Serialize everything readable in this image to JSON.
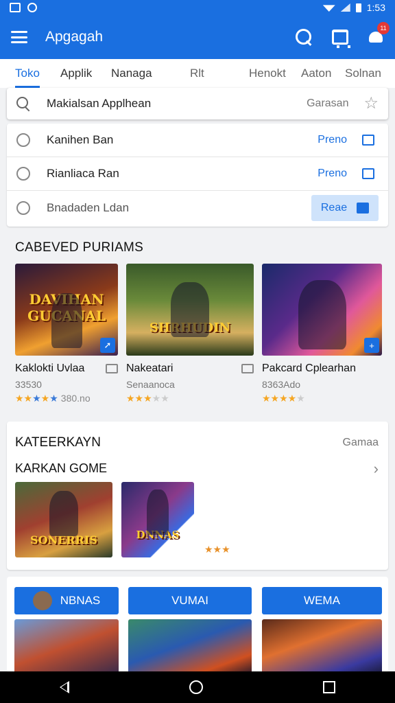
{
  "status_bar": {
    "time": "1:53"
  },
  "app_bar": {
    "title": "Apgagah",
    "notification_count": "11"
  },
  "tabs": [
    {
      "label": "Toko",
      "active": true
    },
    {
      "label": "Applik",
      "active": false
    },
    {
      "label": "Nanaga",
      "active": false
    },
    {
      "label": "Rlt",
      "active": false
    },
    {
      "label": "Henokt",
      "active": false
    },
    {
      "label": "Aaton",
      "active": false
    },
    {
      "label": "Solnan",
      "active": false
    }
  ],
  "search": {
    "query": "Makialsan Applhean",
    "scope": "Garasan"
  },
  "list": [
    {
      "label": "Kanihen Ban",
      "tag": "Preno",
      "selected": false
    },
    {
      "label": "Rianliaca Ran",
      "tag": "Preno",
      "selected": false
    },
    {
      "label": "Bnadaden Ldan",
      "tag": "Reae",
      "selected": true
    }
  ],
  "section_featured": {
    "title": "CABEVED PURIAMS",
    "games": [
      {
        "art_title": "DAVIHAN GUCANAL",
        "name": "Kaklokti Uvlaa",
        "sub": "33530",
        "rating": 4,
        "rating_text": "380.no"
      },
      {
        "art_title": "SHRHUDIN",
        "name": "Nakeatari",
        "sub": "Senaanoca",
        "rating": 3,
        "rating_text": ""
      },
      {
        "art_title": "",
        "name": "Pakcard Cplearhan",
        "sub": "8363Ado",
        "rating": 4,
        "rating_text": ""
      }
    ]
  },
  "section_category": {
    "title": "KATEERKAYN",
    "action": "Gamaa",
    "subtitle": "KARKAN GOME",
    "thumbs": [
      {
        "art_title": "SONERRIS"
      },
      {
        "art_title": "DNNAS"
      }
    ],
    "rating": 3
  },
  "categories": [
    {
      "label": "NBNAS"
    },
    {
      "label": "VUMAI"
    },
    {
      "label": "WEMA"
    }
  ],
  "colors": {
    "accent": "#1a6fe0",
    "star": "#f5a623"
  }
}
